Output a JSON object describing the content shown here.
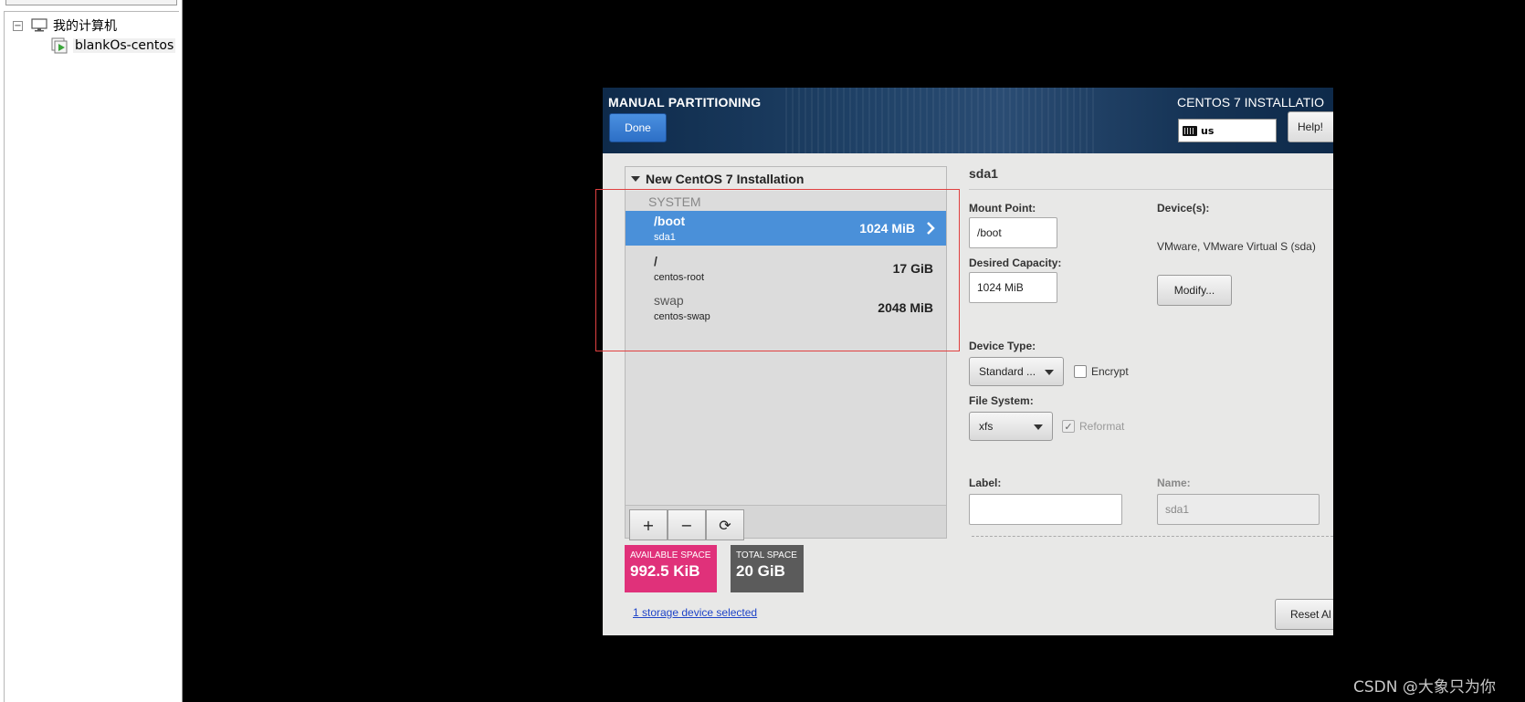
{
  "tree": {
    "root_label": "我的计算机",
    "root_toggle": "−",
    "child_label": "blankOs-centos"
  },
  "installer": {
    "header": {
      "title": "MANUAL PARTITIONING",
      "done_label": "Done",
      "product_title": "CENTOS 7 INSTALLATIO",
      "keyboard_layout": "us",
      "help_label": "Help!"
    },
    "partitions": {
      "group_title": "New CentOS 7 Installation",
      "section_label": "SYSTEM",
      "rows": [
        {
          "mount": "/boot",
          "device": "sda1",
          "size": "1024 MiB",
          "selected": true
        },
        {
          "mount": "/",
          "device": "centos-root",
          "size": "17 GiB",
          "selected": false
        },
        {
          "mount": "swap",
          "device": "centos-swap",
          "size": "2048 MiB",
          "selected": false
        }
      ],
      "toolbar": {
        "add": "+",
        "remove": "−",
        "refresh": "⟳"
      }
    },
    "space": {
      "available_caption": "AVAILABLE SPACE",
      "available_value": "992.5 KiB",
      "total_caption": "TOTAL SPACE",
      "total_value": "20 GiB"
    },
    "storage_link": "1 storage device selected",
    "detail": {
      "title": "sda1",
      "mount_point_label": "Mount Point:",
      "mount_point_value": "/boot",
      "desired_capacity_label": "Desired Capacity:",
      "desired_capacity_value": "1024 MiB",
      "devices_label": "Device(s):",
      "devices_value": "VMware, VMware Virtual S (sda)",
      "modify_label": "Modify...",
      "device_type_label": "Device Type:",
      "device_type_value": "Standard ...",
      "encrypt_label": "Encrypt",
      "file_system_label": "File System:",
      "file_system_value": "xfs",
      "reformat_label": "Reformat",
      "label_label": "Label:",
      "label_value": "",
      "name_label": "Name:",
      "name_value": "sda1",
      "reset_label": "Reset Al"
    }
  },
  "watermark": "CSDN @大象只为你",
  "colors": {
    "selected_row": "#4a90d9",
    "available_space": "#e0317a",
    "total_space": "#5b5b5b",
    "done_button": "#2d6fc6",
    "annotation_border": "#e04040"
  }
}
